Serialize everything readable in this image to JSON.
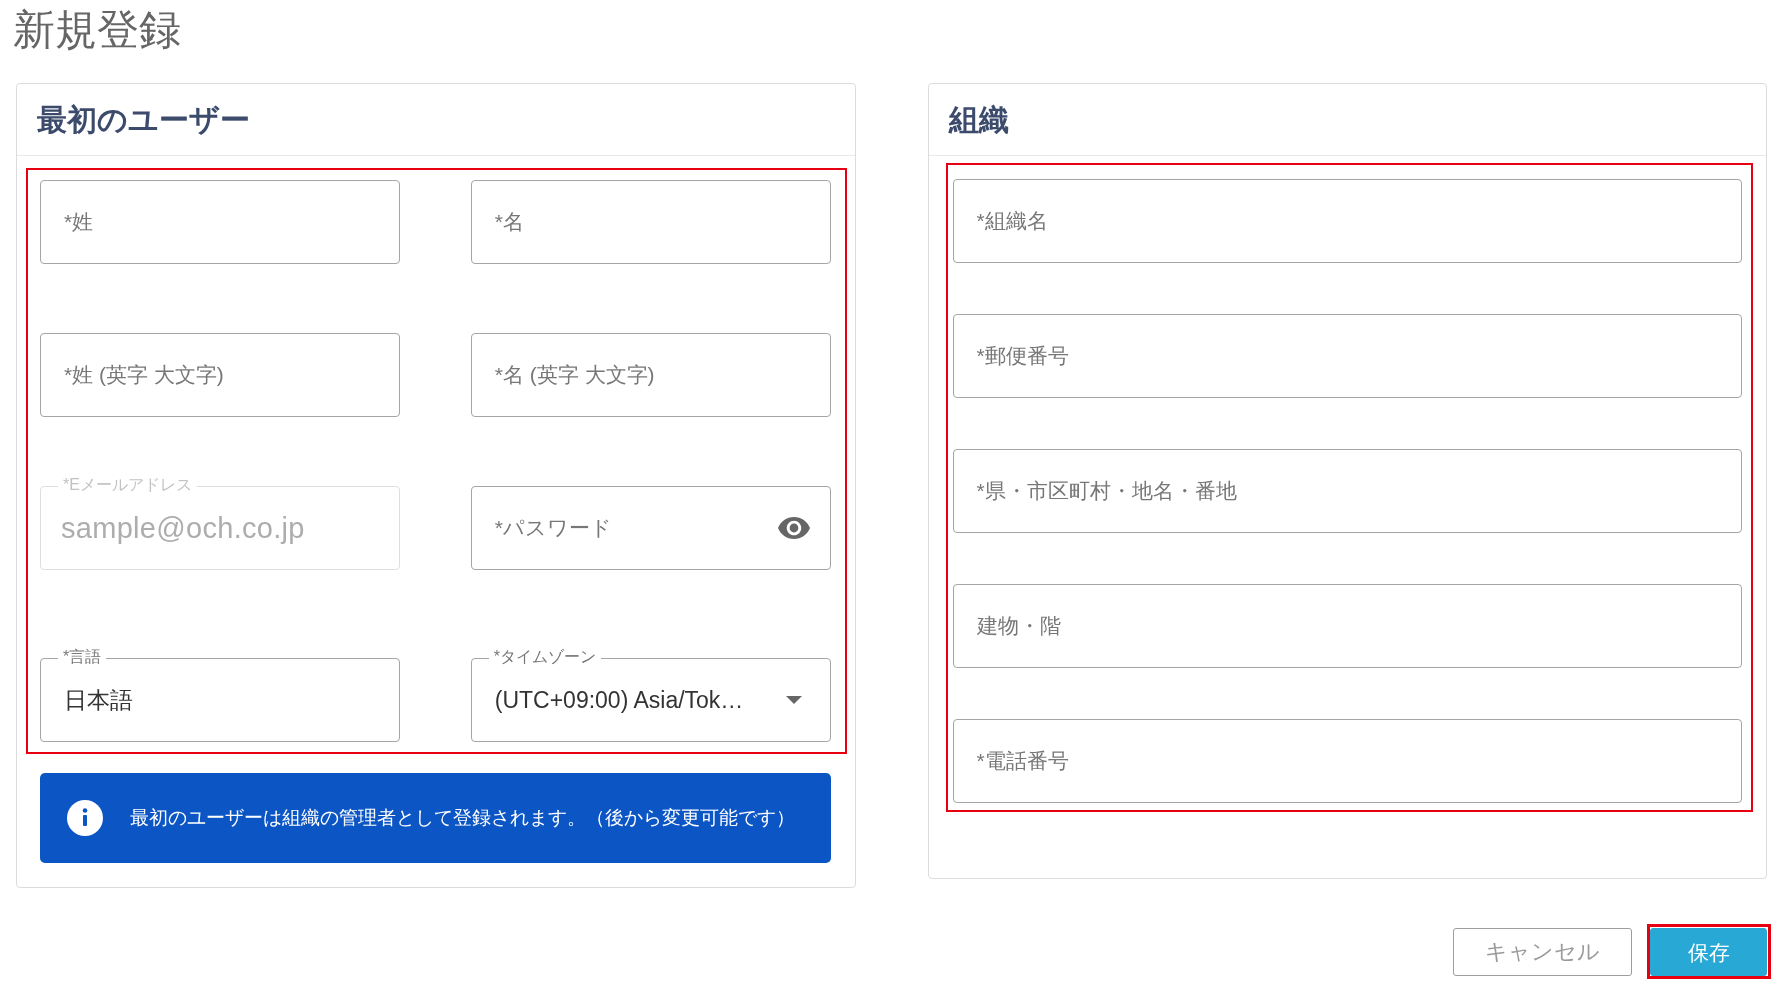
{
  "page_title": "新規登録",
  "user_card": {
    "title": "最初のユーザー",
    "highlighted": true,
    "fields": [
      {
        "kind": "text",
        "placeholder": "*姓",
        "disabled": false
      },
      {
        "kind": "text",
        "placeholder": "*名",
        "disabled": false
      },
      {
        "kind": "text",
        "placeholder": "*姓 (英字 大文字)",
        "disabled": false
      },
      {
        "kind": "text",
        "placeholder": "*名 (英字 大文字)",
        "disabled": false
      },
      {
        "kind": "text",
        "label": "*Eメールアドレス",
        "value": "sample@och.co.jp",
        "disabled": true
      },
      {
        "kind": "password",
        "placeholder": "*パスワード",
        "disabled": false
      },
      {
        "kind": "text",
        "label": "*言語",
        "value": "日本語",
        "disabled": false
      },
      {
        "kind": "select",
        "label": "*タイムゾーン",
        "value": "(UTC+09:00) Asia/Tok…",
        "disabled": false
      }
    ],
    "notice": "最初のユーザーは組織の管理者として登録されます。（後から変更可能です）"
  },
  "organization_card": {
    "title": "組織",
    "highlighted": true,
    "fields": [
      {
        "kind": "text",
        "placeholder": "*組織名"
      },
      {
        "kind": "text",
        "placeholder": "*郵便番号"
      },
      {
        "kind": "text",
        "placeholder": "*県・市区町村・地名・番地"
      },
      {
        "kind": "text",
        "placeholder": "建物・階"
      },
      {
        "kind": "text",
        "placeholder": "*電話番号"
      }
    ]
  },
  "buttons": [
    {
      "kind": "secondary",
      "label": "キャンセル",
      "highlighted": false
    },
    {
      "kind": "primary",
      "label": "保存",
      "highlighted": true
    }
  ]
}
